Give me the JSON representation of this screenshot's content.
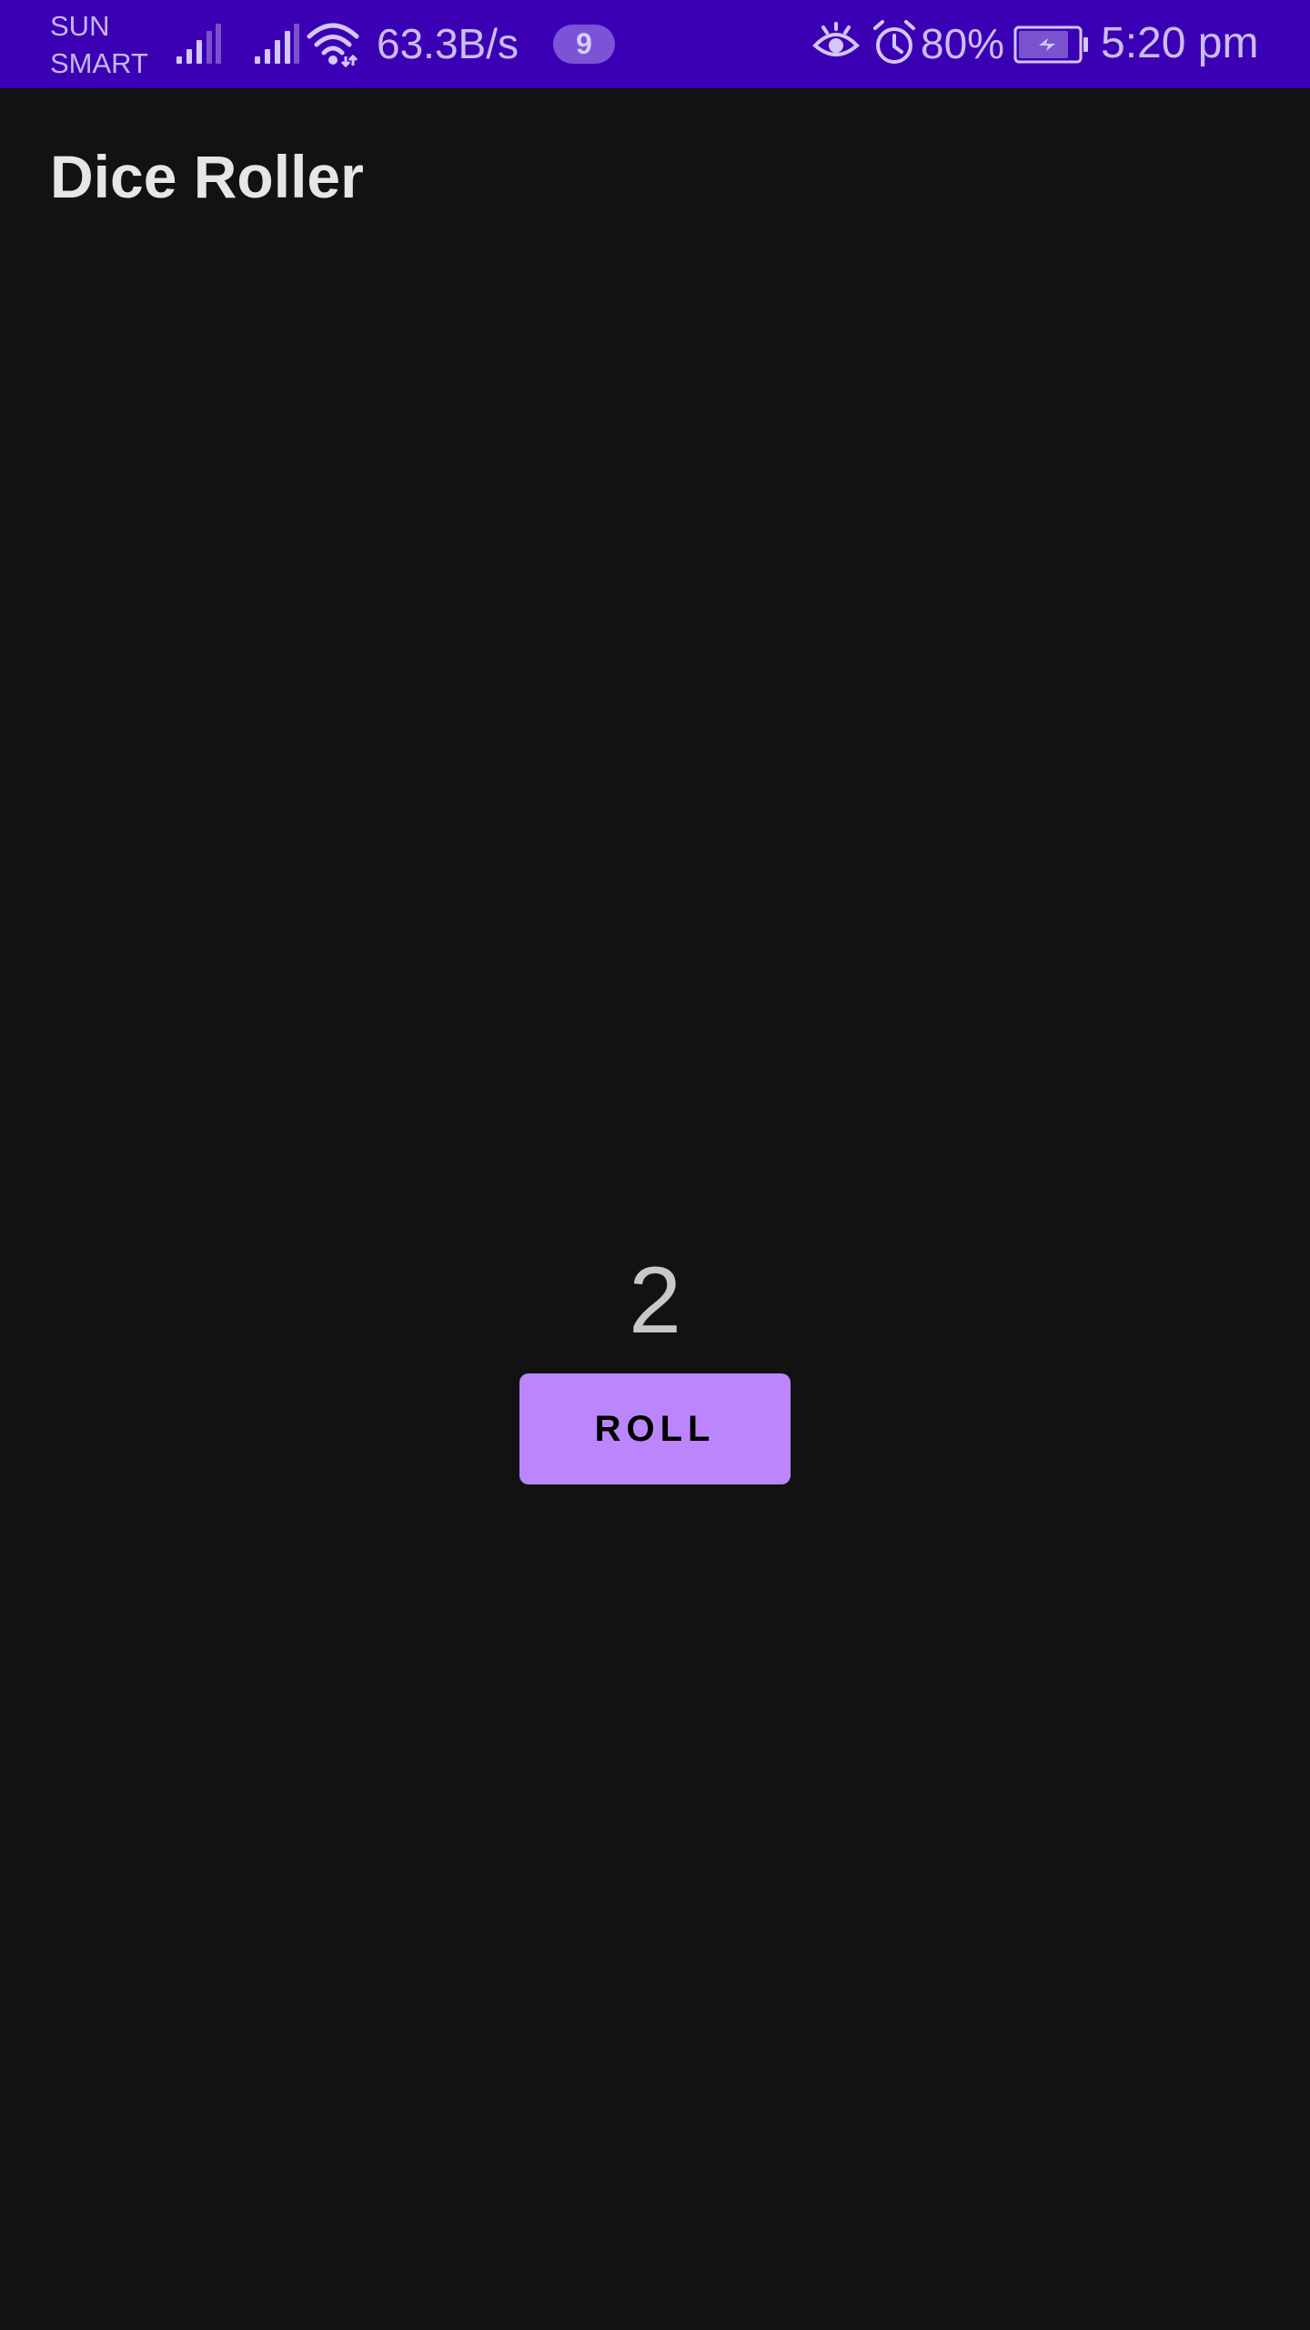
{
  "status_bar": {
    "carrier_line1": "SUN",
    "carrier_line2": "SMART",
    "net_speed": "63.3B/s",
    "notification_count": "9",
    "battery_percent": "80%",
    "time": "5:20 pm",
    "icons": [
      "signal-icon",
      "signal-icon",
      "wifi-icon",
      "eye-icon",
      "alarm-icon",
      "battery-charging-icon"
    ],
    "background_color": "#3c00b4"
  },
  "app_bar": {
    "title": "Dice Roller"
  },
  "main": {
    "dice_value": "2",
    "roll_label": "ROLL",
    "button_color": "#bb86fc",
    "background_color": "#121212"
  }
}
